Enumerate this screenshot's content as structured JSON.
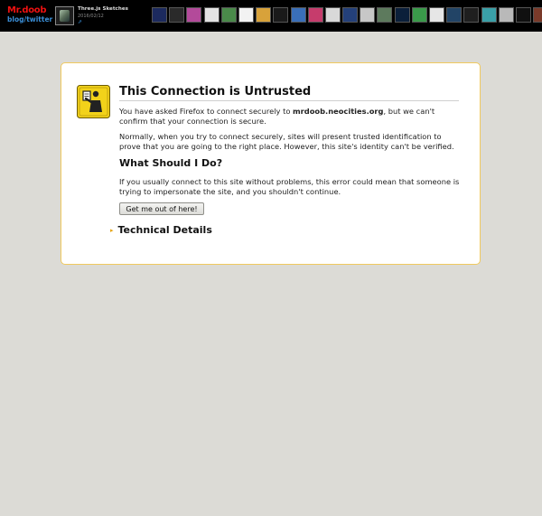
{
  "topbar": {
    "brand": "Mr.doob",
    "brand_sub": "blog/twitter",
    "project": {
      "title": "Three.js Sketches",
      "date": "2016/02/12",
      "link_icon": "external-link-icon"
    },
    "thumb_colors": [
      "#1c2a5e",
      "#2a2a2a",
      "#b34a9a",
      "#e3e3e3",
      "#4a8a4a",
      "#f2f2f2",
      "#d8a23a",
      "#1a1a1a",
      "#3a6fb8",
      "#c63c6c",
      "#d9d9d9",
      "#24407a",
      "#c7c7c7",
      "#5d7a5d",
      "#0b1f3a",
      "#3a9a4a",
      "#e6e6e6",
      "#224466",
      "#1f1f1f",
      "#3aa0a8",
      "#b9b9b9",
      "#101010",
      "#7a3a2a",
      "#c84a1a",
      "#2a2a2a",
      "#6a6a6a",
      "#3a3a3a",
      "#1a1a1a",
      "#c22",
      "#f0f0f0",
      "#8aa0c0",
      "#e8e8e8",
      "#3a3a6a"
    ]
  },
  "dialog": {
    "icon": "warning-policeman-icon",
    "title": "This Connection is Untrusted",
    "intro_before": "You have asked Firefox to connect securely to ",
    "domain": "mrdoob.neocities.org",
    "intro_after": ", but we can't confirm that your connection is secure.",
    "normally": "Normally, when you try to connect securely, sites will present trusted identification to prove that you are going to the right place. However, this site's identity can't be verified.",
    "heading": "What Should I Do?",
    "advice": "If you usually connect to this site without problems, this error could mean that someone is trying to impersonate the site, and you shouldn't continue.",
    "button_label": "Get me out of here!",
    "tech_arrow": "▸",
    "tech_label": "Technical Details"
  },
  "colors": {
    "page_bg": "#dcdbd6",
    "dialog_border": "#f0c95e",
    "brand_red": "#ee1111",
    "link_blue": "#3a8fd8"
  }
}
